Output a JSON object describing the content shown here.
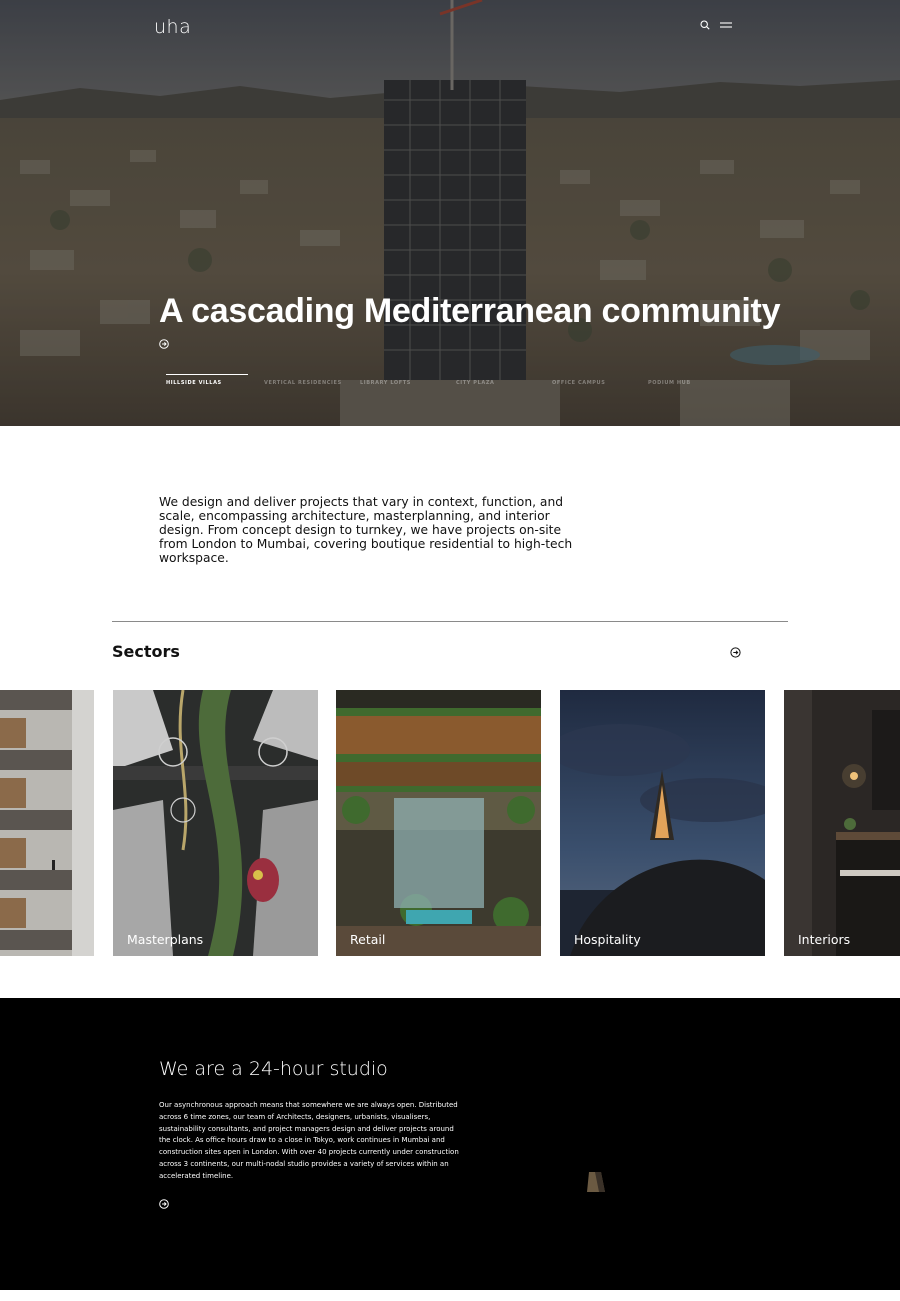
{
  "header": {
    "logo": "uha",
    "icons": [
      "search-icon",
      "menu-icon"
    ]
  },
  "hero": {
    "title": "A cascading Mediterranean community",
    "tabs": [
      {
        "label": "HILLSIDE VILLAS",
        "active": true
      },
      {
        "label": "VERTICAL RESIDENCIES",
        "active": false
      },
      {
        "label": "LIBRARY LOFTS",
        "active": false
      },
      {
        "label": "CITY PLAZA",
        "active": false
      },
      {
        "label": "OFFICE CAMPUS",
        "active": false
      },
      {
        "label": "PODIUM HUB",
        "active": false
      }
    ]
  },
  "intro": {
    "text": "We design and deliver projects that vary in context, function, and scale, encompassing architecture, masterplanning, and interior design. From concept design to turnkey, we have projects on-site from London to Mumbai, covering boutique residential to high-tech workspace."
  },
  "sectors": {
    "title": "Sectors",
    "cards": [
      {
        "label": ""
      },
      {
        "label": "Masterplans"
      },
      {
        "label": "Retail"
      },
      {
        "label": "Hospitality"
      },
      {
        "label": "Interiors"
      }
    ]
  },
  "studio": {
    "title": "We are a 24-hour studio",
    "text": "Our asynchronous approach means that somewhere we are always open. Distributed across 6 time zones, our team of Architects, designers, urbanists, visualisers, sustainability consultants, and project managers design and deliver projects around the clock. As office hours draw to a close in Tokyo, work continues in Mumbai and construction sites open in London. With over 40 projects currently under construction across 3 continents, our multi-nodal studio provides a variety of services within an accelerated timeline."
  },
  "colors": {
    "studio_bg": "#000000",
    "text": "#111111",
    "divider": "#8a8a8a"
  }
}
